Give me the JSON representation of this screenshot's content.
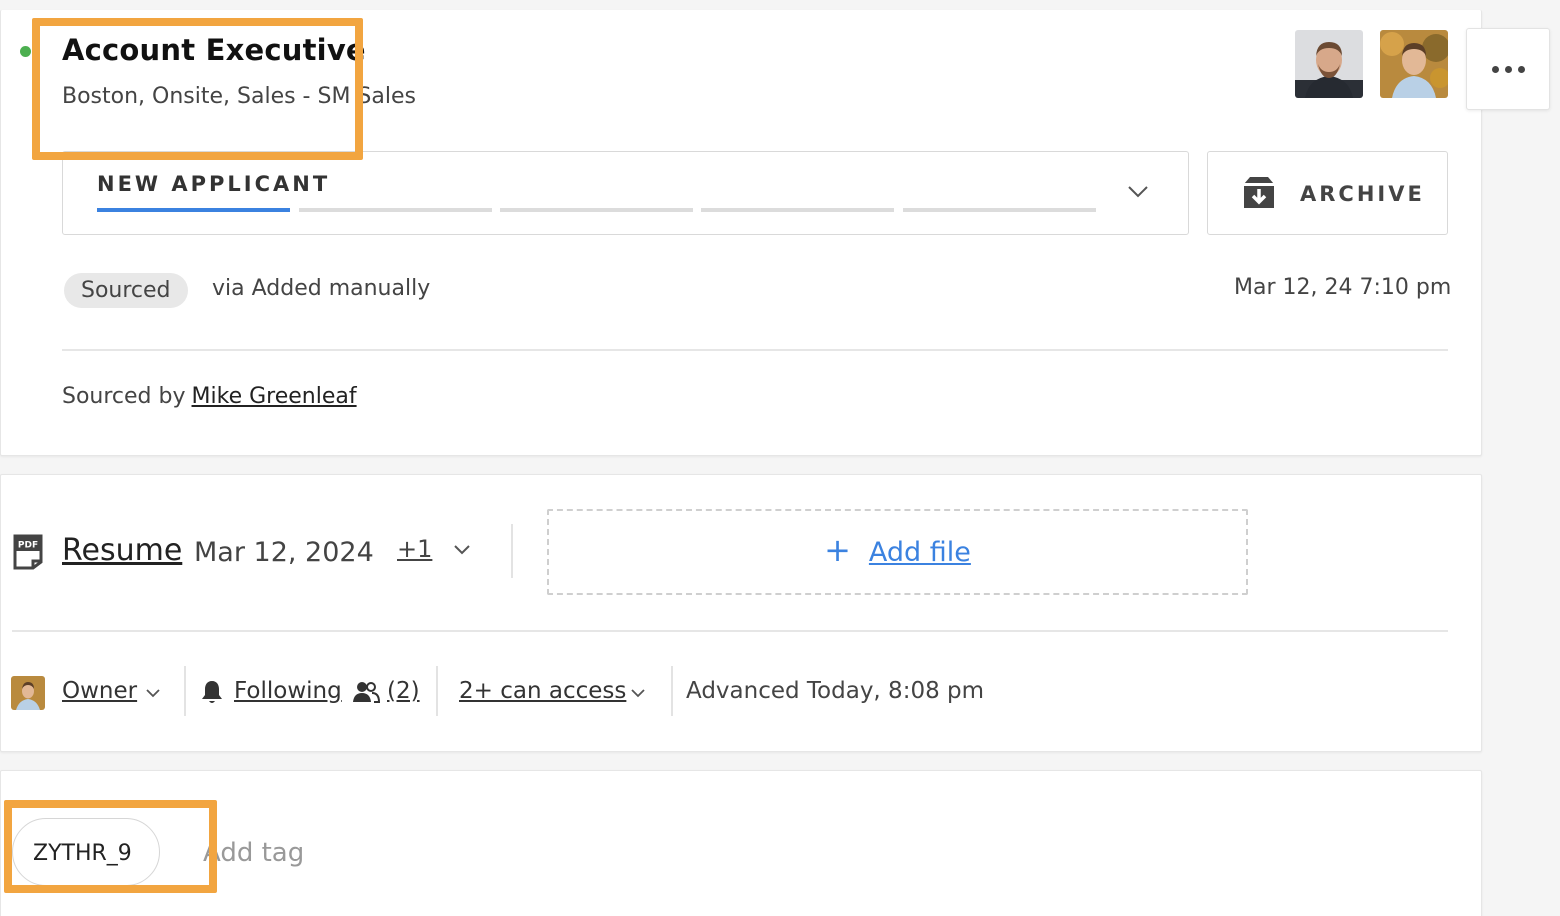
{
  "job": {
    "title": "Account Executive",
    "subtitle": "Boston, Onsite, Sales - SM  Sales"
  },
  "stage": {
    "current": "NEW APPLICANT",
    "total_steps": 5,
    "active_step": 1
  },
  "archive": {
    "label": "ARCHIVE"
  },
  "source": {
    "badge": "Sourced",
    "via": "via Added manually",
    "date": "Mar 12, 24 7:10 pm",
    "sourced_by_label": "Sourced by",
    "sourced_by_name": "Mike Greenleaf"
  },
  "files": {
    "resume_label": "Resume",
    "resume_date": "Mar 12, 2024",
    "extra_count": "+1",
    "add_file_label": "Add file",
    "add_file_plus": "+"
  },
  "meta": {
    "owner_label": "Owner",
    "following_label": "Following",
    "followers_count": "(2)",
    "access_label": "2+ can access",
    "advanced_text": "Advanced Today, 8:08 pm"
  },
  "tags": {
    "items": [
      "ZYTHR_9"
    ],
    "add_placeholder": "Add tag"
  },
  "colors": {
    "accent": "#3b82e0",
    "status_dot": "#4caf50",
    "highlight": "#f2a540"
  }
}
